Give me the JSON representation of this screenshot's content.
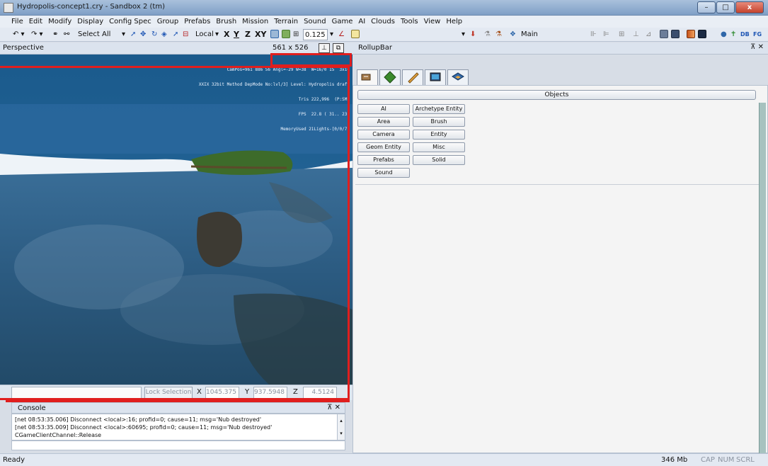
{
  "window": {
    "title": "Hydropolis-concept1.cry - Sandbox 2 (tm)",
    "min_label": "–",
    "max_label": "□",
    "close_label": "x"
  },
  "menu": [
    "File",
    "Edit",
    "Modify",
    "Display",
    "Config Spec",
    "Group",
    "Prefabs",
    "Brush",
    "Mission",
    "Terrain",
    "Sound",
    "Game",
    "AI",
    "Clouds",
    "Tools",
    "View",
    "Help"
  ],
  "toolbar": {
    "select_all": "Select All",
    "coord_system": "Local",
    "axis_x": "X",
    "axis_y": "Y",
    "axis_z": "Z",
    "axis_xy": "XY",
    "grid_value": "0.125",
    "layer": "Main",
    "db_label": "DB",
    "fg_label": "FG"
  },
  "viewport": {
    "title": "Perspective",
    "size": "561 x 526",
    "hud_lines": [
      "CamPos=961 886 56 Angl=-29 W=38  W=16/0 15  3x10",
      "XXIX 32bit Method DepMode No:lvl/3] Level: Hydropolis draft",
      "Tris 222,996  (P:SM)",
      "FPS  22.8 ( 31.. 23)",
      "MemoryUsed 21Lights-[0/0/7]"
    ]
  },
  "coords": {
    "lock_selection": "Lock Selection",
    "x_label": "X",
    "x_value": "1045.375",
    "y_label": "Y",
    "y_value": "937.5948",
    "z_label": "Z",
    "z_value": "4.5124"
  },
  "console": {
    "title": "Console",
    "lines": [
      "[net 08:53:35.006] Disconnect <local>:16; profid=0; cause=11; msg='Nub destroyed'",
      "[net 08:53:35.009] Disconnect <local>:60695; profid=0; cause=11; msg='Nub destroyed'",
      "CGameClientChannel::Release"
    ],
    "pin": "⊼ ✕"
  },
  "rollup": {
    "title": "RollupBar",
    "pin": "⊼ ✕",
    "section": "Objects",
    "buttons": [
      "AI",
      "Archetype Entity",
      "Area",
      "Brush",
      "Camera",
      "Entity",
      "Geom Entity",
      "Misc",
      "Prefabs",
      "Solid",
      "Sound"
    ]
  },
  "status": {
    "ready": "Ready",
    "memory": "346 Mb",
    "cap": "CAP",
    "num": "NUM",
    "scrl": "SCRL"
  },
  "colors": {
    "highlight_frame": "#e01e1e",
    "ocean": "#1f4f7a",
    "snow": "#f2f6fa"
  }
}
